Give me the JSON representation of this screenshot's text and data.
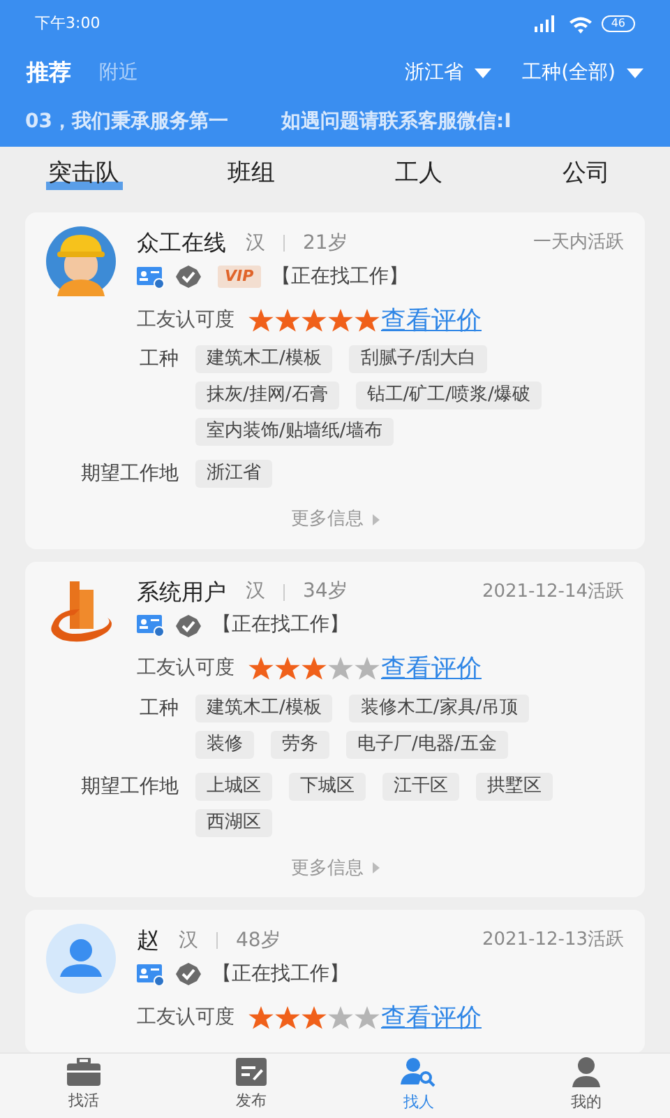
{
  "status_bar": {
    "time": "下午3:00",
    "battery": "46"
  },
  "header": {
    "tabs": [
      {
        "label": "推荐",
        "selected": true
      },
      {
        "label": "附近",
        "selected": false
      }
    ],
    "filters": [
      {
        "label": "浙江省"
      },
      {
        "label": "工种(全部)"
      }
    ]
  },
  "marquee": [
    "03，我们秉承服务第一",
    "如遇问题请联系客服微信:I"
  ],
  "category_tabs": [
    {
      "label": "突击队",
      "selected": true
    },
    {
      "label": "班组",
      "selected": false
    },
    {
      "label": "工人",
      "selected": false
    },
    {
      "label": "公司",
      "selected": false
    }
  ],
  "workers": [
    {
      "kind": "helmet",
      "name": "众工在线",
      "ethnicity": "汉",
      "age": "21岁",
      "active": "一天内活跃",
      "vip_badge": "VIP",
      "status": "【正在找工作】",
      "rating_label": "工友认可度",
      "stars": 5,
      "review_link": "查看评价",
      "trades_label": "工种",
      "trades": [
        "建筑木工/模板",
        "刮腻子/刮大白",
        "抹灰/挂网/石膏",
        "钻工/矿工/喷浆/爆破",
        "室内装饰/贴墙纸/墙布"
      ],
      "place_label": "期望工作地",
      "places": [
        "浙江省"
      ],
      "more": "更多信息"
    },
    {
      "kind": "logo",
      "name": "系统用户",
      "ethnicity": "汉",
      "age": "34岁",
      "active": "2021-12-14活跃",
      "status": "【正在找工作】",
      "rating_label": "工友认可度",
      "stars": 3,
      "review_link": "查看评价",
      "trades_label": "工种",
      "trades": [
        "建筑木工/模板",
        "装修木工/家具/吊顶",
        "装修",
        "劳务",
        "电子厂/电器/五金"
      ],
      "place_label": "期望工作地",
      "places": [
        "上城区",
        "下城区",
        "江干区",
        "拱墅区",
        "西湖区"
      ],
      "more": "更多信息"
    },
    {
      "kind": "person",
      "name": "赵",
      "ethnicity": "汉",
      "age": "48岁",
      "active": "2021-12-13活跃",
      "status": "【正在找工作】",
      "rating_label": "工友认可度",
      "stars": 3,
      "review_link": "查看评价"
    }
  ],
  "bottom_nav": [
    {
      "label": "找活",
      "kind": "briefcase",
      "selected": false
    },
    {
      "label": "发布",
      "kind": "edit",
      "selected": false
    },
    {
      "label": "找人",
      "kind": "find",
      "selected": true
    },
    {
      "label": "我的",
      "kind": "person",
      "selected": false
    }
  ]
}
